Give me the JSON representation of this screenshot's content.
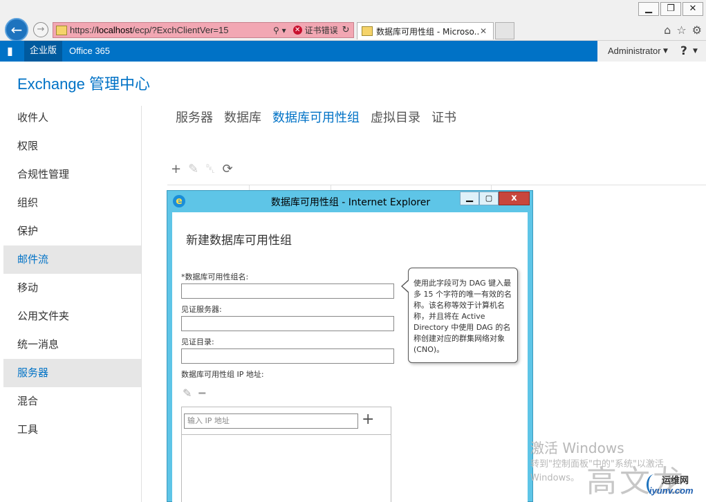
{
  "browser": {
    "window_buttons": [
      "▁",
      "❐",
      "✕"
    ],
    "address": {
      "prefix": "https://",
      "host": "localhost",
      "path": "/ecp/?ExchClientVer=15",
      "search_glyph": "⚲ ▾",
      "cert_error": "证书错误",
      "refresh_glyph": "↻"
    },
    "tab_title": "数据库可用性组 - Microso...",
    "tab_close": "✕",
    "right_icons": [
      "⌂",
      "☆",
      "⚙"
    ],
    "back_glyph": "←",
    "forward_glyph": "→"
  },
  "o365": {
    "logo_glyph": "▮",
    "enterprise": "企业版",
    "office365": "Office 365",
    "user": "Administrator",
    "caret": "▼",
    "help": "?"
  },
  "app_title": "Exchange 管理中心",
  "leftnav": [
    {
      "label": "收件人",
      "selected": false
    },
    {
      "label": "权限",
      "selected": false
    },
    {
      "label": "合规性管理",
      "selected": false
    },
    {
      "label": "组织",
      "selected": false
    },
    {
      "label": "保护",
      "selected": false
    },
    {
      "label": "邮件流",
      "selected": true
    },
    {
      "label": "移动",
      "selected": false
    },
    {
      "label": "公用文件夹",
      "selected": false
    },
    {
      "label": "统一消息",
      "selected": false
    },
    {
      "label": "服务器",
      "selected": true
    },
    {
      "label": "混合",
      "selected": false
    },
    {
      "label": "工具",
      "selected": false
    }
  ],
  "subnav": {
    "items": [
      "服务器",
      "数据库",
      "数据库可用性组",
      "虚拟目录",
      "证书"
    ],
    "active": "数据库可用性组"
  },
  "toolbar": {
    "add": "+",
    "edit": "✎",
    "delete": "🗑",
    "refresh": "⟳"
  },
  "popup": {
    "icon_glyph": "e",
    "title": "数据库可用性组 - Internet Explorer",
    "min": "▁",
    "max": "▢",
    "close": "x",
    "form_title": "新建数据库可用性组",
    "dag_name_label": "*数据库可用性组名:",
    "witness_server_label": "见证服务器:",
    "witness_dir_label": "见证目录:",
    "ip_label": "数据库可用性组 IP 地址:",
    "ip_placeholder": "输入 IP 地址",
    "ip_add": "+",
    "ip_edit": "✎",
    "ip_remove": "━"
  },
  "callout": "使用此字段可为 DAG 键入最多 15 个字符的唯一有效的名称。该名称等效于计算机名称，并且将在 Active Directory 中使用 DAG 的名称创建对应的群集网络对象(CNO)。",
  "watermark": {
    "line1": "激活 Windows",
    "line2": "转到\"控制面板\"中的\"系统\"以激活",
    "line3": "Windows。",
    "brand": "高文龙",
    "site_cn": "运维网",
    "site_url": "iyunv.com"
  }
}
